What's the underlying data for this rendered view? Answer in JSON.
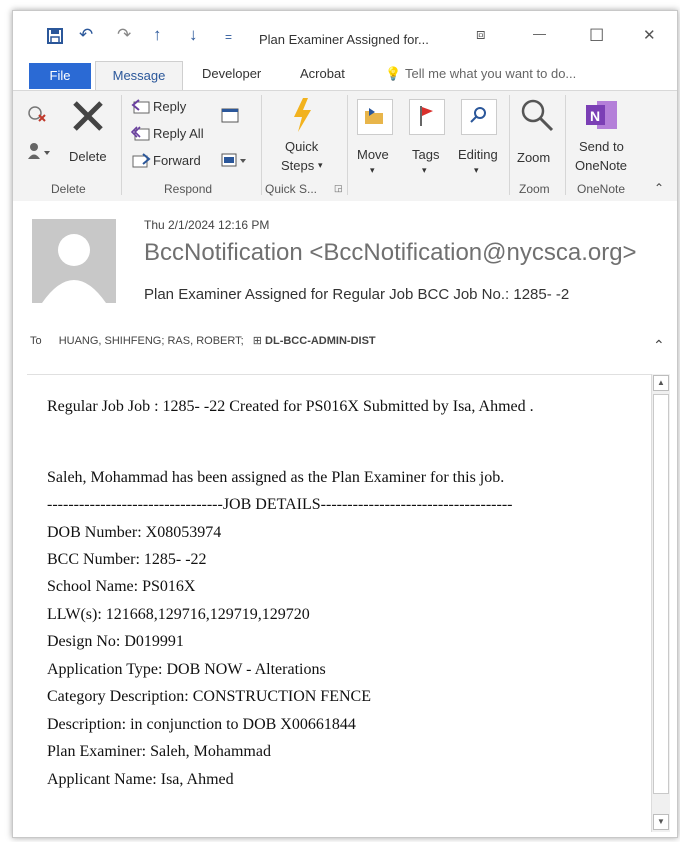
{
  "window": {
    "title": "Plan Examiner Assigned for...",
    "qat": {
      "save_icon": "save-icon",
      "undo": "↶",
      "redo": "↷",
      "up": "↑",
      "down": "↓",
      "more": "="
    },
    "controls": {
      "restore": "⧈",
      "minimize": "—",
      "maximize": "☐",
      "close": "✕"
    }
  },
  "tabs": {
    "file": "File",
    "message": "Message",
    "developer": "Developer",
    "acrobat": "Acrobat",
    "tell_me": "Tell me what you want to do..."
  },
  "ribbon": {
    "delete_label": "Delete",
    "reply": "Reply",
    "reply_all": "Reply All",
    "forward": "Forward",
    "quick_steps_1": "Quick",
    "quick_steps_2": "Steps",
    "move": "Move",
    "tags": "Tags",
    "editing": "Editing",
    "zoom": "Zoom",
    "send_1": "Send to",
    "send_2": "OneNote",
    "groups": {
      "delete": "Delete",
      "respond": "Respond",
      "quick_steps": "Quick S...",
      "zoom": "Zoom",
      "onenote": "OneNote"
    }
  },
  "message": {
    "date": "Thu 2/1/2024 12:16 PM",
    "from": "BccNotification <BccNotification@nycsca.org>",
    "subject": "Plan Examiner Assigned for Regular Job BCC Job No.: 1285-  -2",
    "to_label": "To",
    "recipients": "HUANG, SHIHFENG; RAS, ROBERT;",
    "dist_list": "DL-BCC-ADMIN-DIST"
  },
  "body": {
    "line1": "Regular Job Job : 1285- -22 Created for PS016X Submitted by Isa, Ahmed .",
    "line2": "Saleh, Mohammad has been assigned as the Plan Examiner for this job.",
    "divider": "---------------------------------JOB DETAILS------------------------------------",
    "details": [
      "DOB Number: X08053974",
      "BCC Number: 1285- -22",
      "School Name: PS016X",
      "LLW(s): 121668,129716,129719,129720",
      "Design No: D019991",
      "Application Type: DOB NOW - Alterations",
      "Category Description: CONSTRUCTION FENCE",
      "Description: in conjunction to DOB X00661844",
      "Plan Examiner: Saleh, Mohammad",
      "Applicant Name: Isa, Ahmed"
    ]
  },
  "colors": {
    "accent": "#2b579a",
    "file_tab": "#2b6ad4",
    "quick_steps": "#f2b21e",
    "onenote": "#7b3fb5",
    "tags_flag": "#d9302c"
  }
}
